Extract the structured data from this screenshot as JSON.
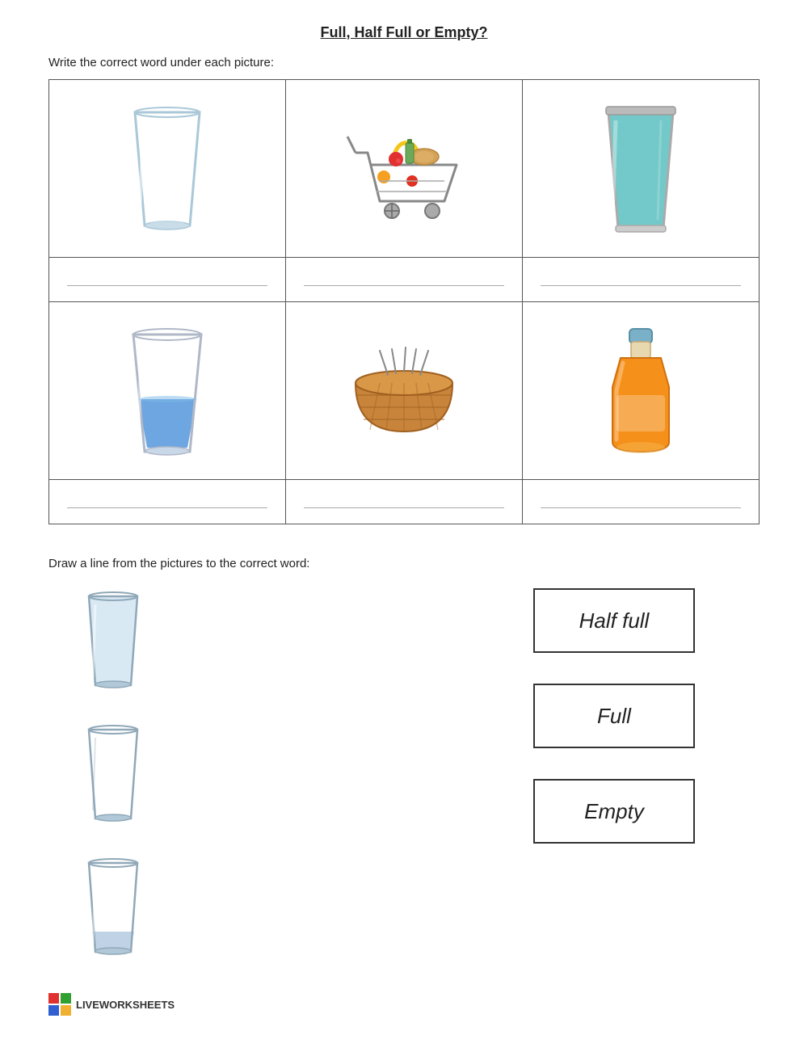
{
  "title": "Full, Half Full or Empty?",
  "instruction1": "Write the correct word under each picture:",
  "instruction2": "Draw a line from the pictures to the correct word:",
  "grid": {
    "rows": [
      {
        "cells": [
          {
            "id": "empty-glass",
            "type": "empty-glass"
          },
          {
            "id": "shopping-cart",
            "type": "shopping-cart"
          },
          {
            "id": "full-glass-teal",
            "type": "full-glass-teal"
          }
        ]
      },
      {
        "cells": [
          {
            "id": "half-glass",
            "type": "half-glass"
          },
          {
            "id": "basket",
            "type": "basket"
          },
          {
            "id": "juice-bottle",
            "type": "juice-bottle"
          }
        ]
      }
    ],
    "answer_row": [
      {
        "id": "ans1",
        "value": ""
      },
      {
        "id": "ans2",
        "value": ""
      },
      {
        "id": "ans3",
        "value": ""
      }
    ],
    "answer_row2": [
      {
        "id": "ans4",
        "value": ""
      },
      {
        "id": "ans5",
        "value": ""
      },
      {
        "id": "ans6",
        "value": ""
      }
    ]
  },
  "matching": {
    "pictures": [
      {
        "id": "match-glass-full",
        "type": "match-full-glass"
      },
      {
        "id": "match-glass-empty",
        "type": "match-empty-glass"
      },
      {
        "id": "match-glass-half",
        "type": "match-half-glass"
      }
    ],
    "words": [
      {
        "id": "word-halffull",
        "label": "Half full"
      },
      {
        "id": "word-full",
        "label": "Full"
      },
      {
        "id": "word-empty",
        "label": "Empty"
      }
    ]
  },
  "footer": {
    "logo_text": "LIVEWORKSHEETS"
  }
}
